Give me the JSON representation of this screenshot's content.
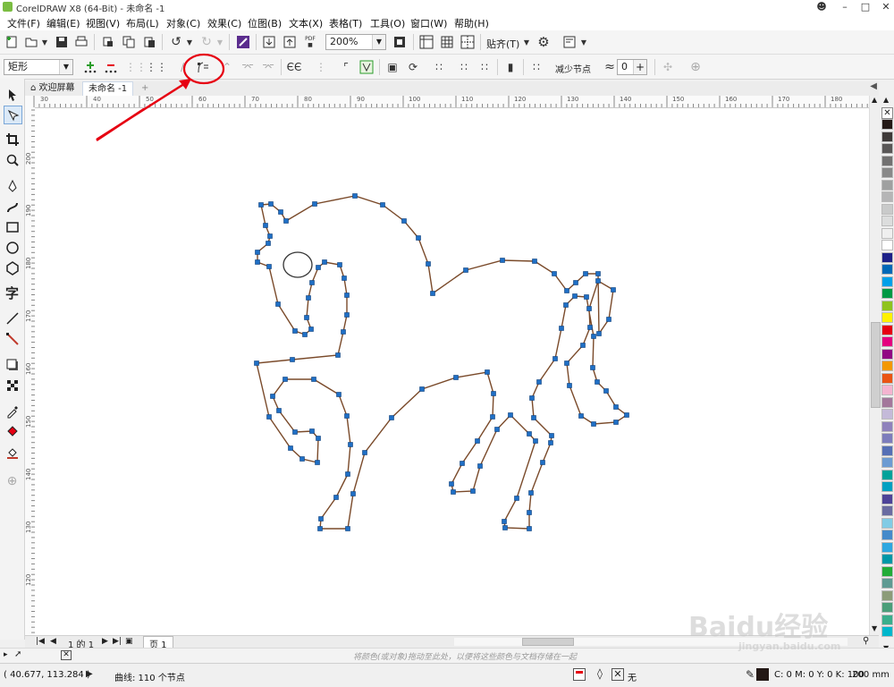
{
  "window": {
    "title": "CorelDRAW X8 (64-Bit) - 未命名 -1",
    "controls": [
      "user-icon",
      "minimize-icon",
      "restore-icon",
      "close-icon"
    ]
  },
  "menu": [
    "文件(F)",
    "编辑(E)",
    "视图(V)",
    "布局(L)",
    "对象(C)",
    "效果(C)",
    "位图(B)",
    "文本(X)",
    "表格(T)",
    "工具(O)",
    "窗口(W)",
    "帮助(H)"
  ],
  "toolbar1": {
    "zoom_value": "200%",
    "snap_label": "贴齐(T)",
    "pdf_label": "PDF"
  },
  "toolbar2": {
    "shape_select_value": "矩形",
    "reduce_nodes_label": "减少节点",
    "smoothing_value": "0"
  },
  "tabs": {
    "welcome": "欢迎屏幕",
    "document": "未命名 -1",
    "add": "+"
  },
  "rulers": {
    "horizontal_ticks": [
      "30",
      "40",
      "50",
      "60",
      "70",
      "80",
      "90",
      "100",
      "110",
      "120",
      "130",
      "140",
      "150",
      "160",
      "170",
      "180"
    ],
    "vertical_ticks": [
      "200",
      "190",
      "180",
      "170",
      "160",
      "150",
      "140",
      "130",
      "120"
    ]
  },
  "pagenav": {
    "page_counter": "1 的 1",
    "page_tab": "页 1"
  },
  "hint": "将颜色(或对象)拖动至此处，以便将这些颜色与文档存储在一起",
  "status": {
    "coordinates": "( 40.677, 113.284 )",
    "selection": "曲线: 110 个节点",
    "outline_none": "无",
    "color_info": "C: 0 M: 0 Y: 0 K: 100",
    "outline_width": ".200 mm"
  },
  "palette_colors": [
    "#231815",
    "#3e3a39",
    "#595757",
    "#727171",
    "#898989",
    "#9fa0a0",
    "#b5b5b6",
    "#c9caca",
    "#dcdddd",
    "#efefef",
    "#ffffff",
    "#1d2088",
    "#0068b7",
    "#00a0e9",
    "#009944",
    "#8fc31f",
    "#fff100",
    "#e60012",
    "#e4007f",
    "#920783",
    "#f39800",
    "#ea5514",
    "#f4b4d0",
    "#a3789b",
    "#c4bad9",
    "#8f82bc",
    "#7d7dbc",
    "#556fb5",
    "#6c9bd2",
    "#00a29a",
    "#00a0c1",
    "#4d4398",
    "#6a6ca1",
    "#80cbe5",
    "#448aca",
    "#2ea7e0",
    "#0097a7",
    "#22ac38",
    "#5e9a92",
    "#8c9c79",
    "#4b9e7a",
    "#3aae8c",
    "#00b7cc"
  ],
  "annotation_color": "#e60012",
  "watermark": {
    "brand": "Baidu经验",
    "url": "jingyan.baidu.com"
  }
}
